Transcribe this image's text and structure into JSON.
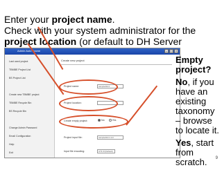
{
  "slide": {
    "title_line1_prefix": "Enter your ",
    "title_line1_bold": "project name",
    "title_line1_suffix": ".",
    "title_line2": "Check with your system administrator for the",
    "title_line3_bold": "project location",
    "title_line3_suffix": " (or default to DH Server directory).",
    "page_number": "9"
  },
  "app": {
    "window_title": "Admin Auto Frame",
    "sidebar_items": [
      "Last used project",
      "TBMBE Project List",
      "BS Project List",
      "Create new TBMBE project",
      "TBMBE Recycle Bin",
      "BS Recycle Bin",
      "Change Admin Password",
      "Email Configuration",
      "Help",
      "Exit"
    ],
    "main_heading": "Create new project",
    "form": {
      "project_name_label": "Project name:",
      "project_name_value": "sampleAbcz",
      "project_location_label": "Project location:",
      "project_location_value": "",
      "empty_project_label": "Create empty project:",
      "radio_no": "No",
      "radio_yes": "Yes",
      "project_input_file_label": "Project input file:",
      "project_input_file_value": "sampleAbcz.xml",
      "encoding_label": "Input file encoding:",
      "encoding_value": "UTF-8 (Default)"
    },
    "colors": {
      "highlight": "#d64f2a",
      "titlebar": "#1f4fb5"
    }
  },
  "note": {
    "question": "Empty project?",
    "no_label": "No",
    "no_text": ", if you have an existing taxonomy – browse to locate it.",
    "yes_label": "Yes",
    "yes_text": ", start from scratch."
  }
}
